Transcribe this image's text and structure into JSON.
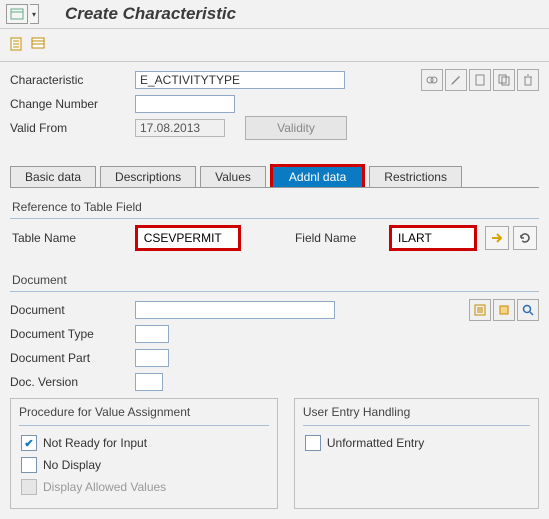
{
  "header": {
    "title": "Create Characteristic"
  },
  "form": {
    "characteristic_label": "Characteristic",
    "characteristic_value": "E_ACTIVITYTYPE",
    "change_number_label": "Change Number",
    "change_number_value": "",
    "valid_from_label": "Valid From",
    "valid_from_value": "17.08.2013",
    "validity_btn": "Validity"
  },
  "tabs": {
    "basic": "Basic data",
    "descriptions": "Descriptions",
    "values": "Values",
    "addnl": "Addnl data",
    "restrictions": "Restrictions"
  },
  "ref": {
    "group_title": "Reference to Table Field",
    "table_label": "Table Name",
    "table_value": "CSEVPERMIT",
    "field_label": "Field Name",
    "field_value": "ILART"
  },
  "doc": {
    "group_title": "Document",
    "document_label": "Document",
    "document_value": "",
    "type_label": "Document Type",
    "type_value": "",
    "part_label": "Document Part",
    "part_value": "",
    "version_label": "Doc. Version",
    "version_value": ""
  },
  "proc": {
    "title": "Procedure for Value Assignment",
    "not_ready": "Not Ready for Input",
    "no_display": "No Display",
    "allowed": "Display Allowed Values"
  },
  "entry": {
    "title": "User Entry Handling",
    "unformatted": "Unformatted Entry"
  }
}
